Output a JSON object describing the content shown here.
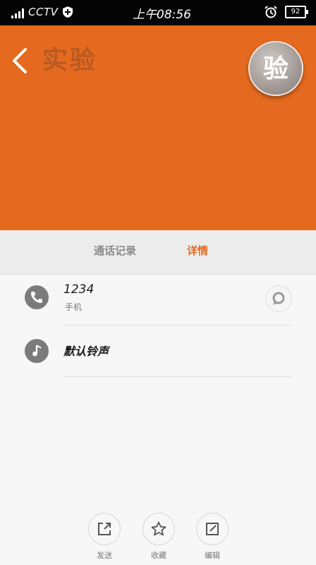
{
  "status_bar": {
    "carrier": "CCTV",
    "time": "上午08:56",
    "battery": "92"
  },
  "header": {
    "contact_name": "实验",
    "avatar_text": "验",
    "back_icon": "chevron-left-icon"
  },
  "tabs": [
    {
      "label": "通话记录",
      "active": false
    },
    {
      "label": "详情",
      "active": true
    }
  ],
  "details": {
    "phone_number": "1234",
    "phone_type": "手机",
    "ringtone_label": "默认铃声"
  },
  "actions": [
    {
      "label": "发送",
      "icon": "share-icon"
    },
    {
      "label": "收藏",
      "icon": "star-icon"
    },
    {
      "label": "编辑",
      "icon": "edit-icon"
    }
  ],
  "colors": {
    "accent": "#e56a1f",
    "status_bar_bg": "#050505"
  }
}
